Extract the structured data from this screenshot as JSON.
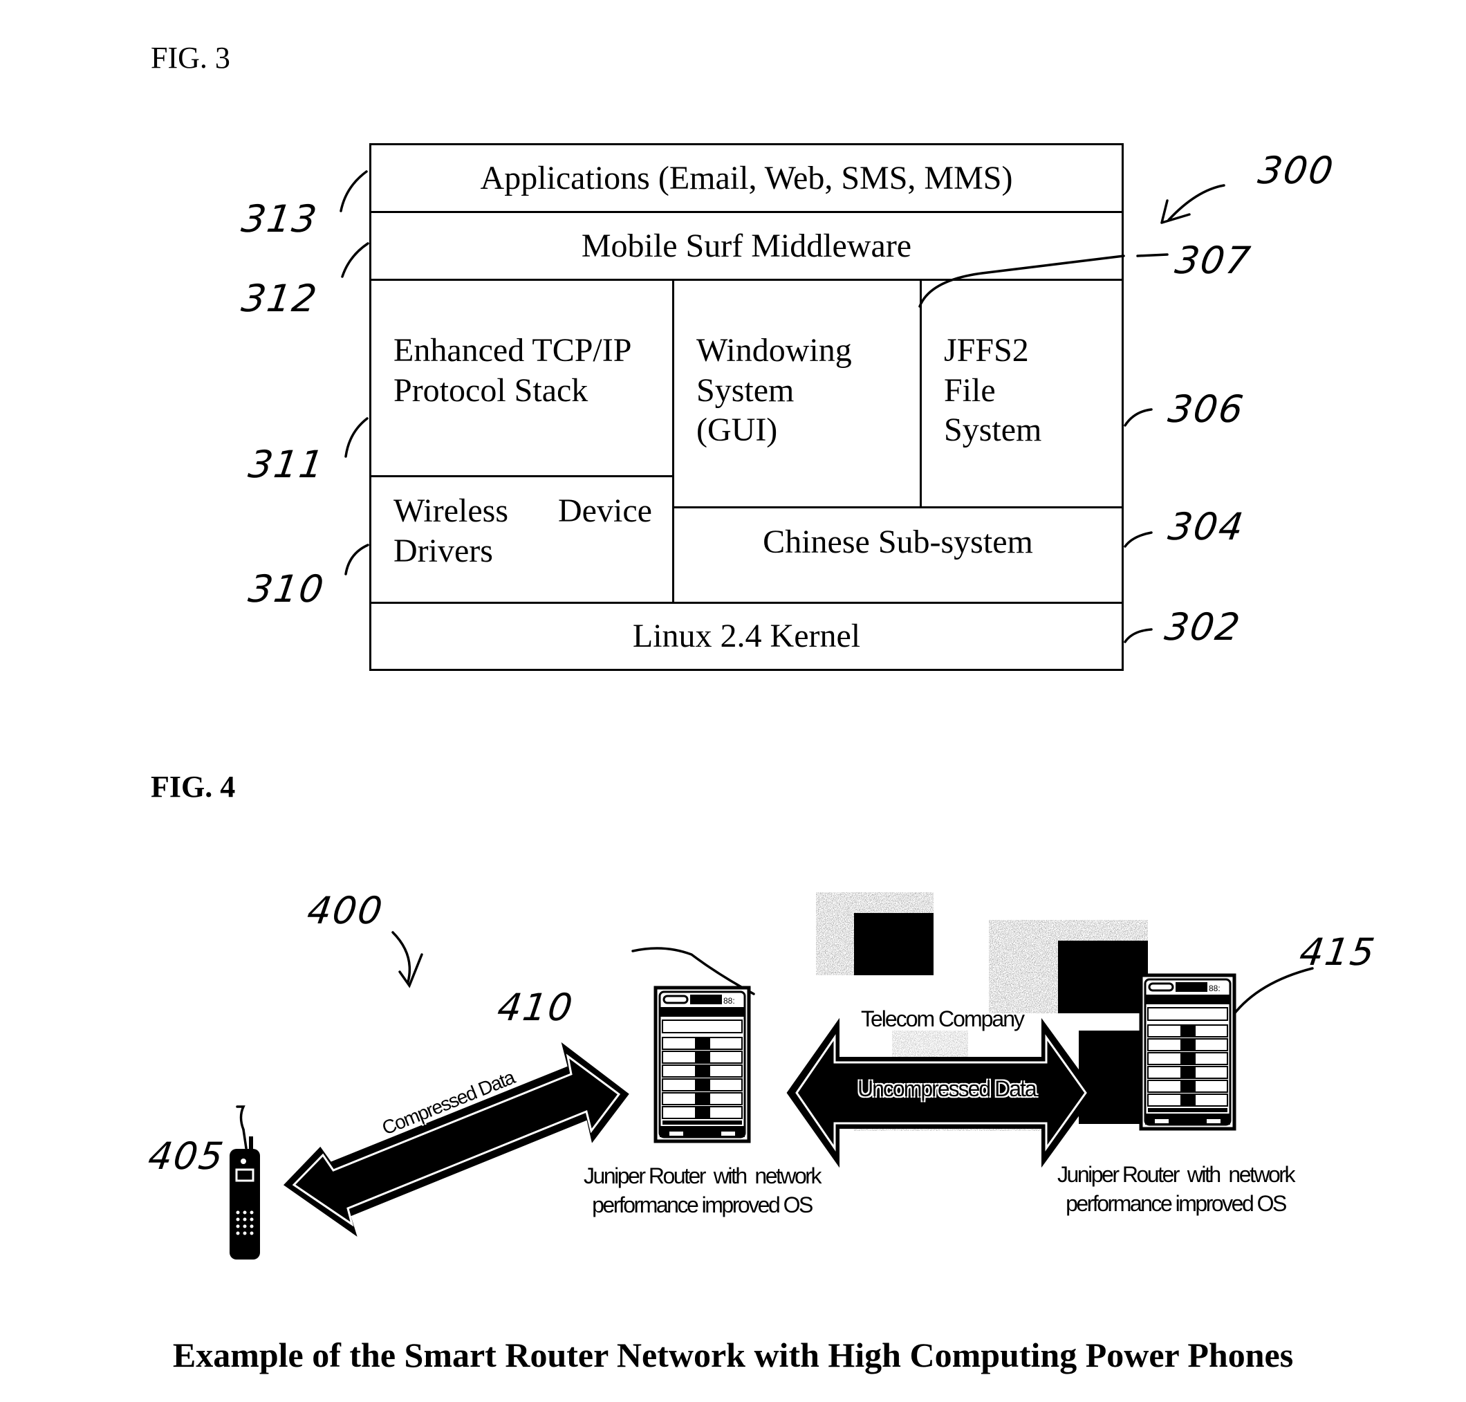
{
  "fig3": {
    "label": "FIG. 3",
    "layers": {
      "applications": "Applications (Email, Web, SMS, MMS)",
      "middleware": "Mobile Surf Middleware",
      "tcpip": [
        "Enhanced TCP/IP",
        "Protocol Stack"
      ],
      "wireless": [
        "Wireless   Device",
        "Drivers"
      ],
      "windowing": [
        "Windowing",
        "System",
        "(GUI)"
      ],
      "jffs2": [
        "JFFS2",
        "File",
        "System"
      ],
      "chinese": "Chinese Sub-system",
      "kernel": "Linux 2.4 Kernel"
    },
    "refs": {
      "r300": "300",
      "r313": "313",
      "r312": "312",
      "r311": "311",
      "r310": "310",
      "r307": "307",
      "r306": "306",
      "r304": "304",
      "r302": "302"
    }
  },
  "fig4": {
    "label": "FIG. 4",
    "refs": {
      "r400": "400",
      "r410": "410",
      "r405": "405",
      "r415": "415"
    },
    "telecom_label": "Telecom Company",
    "compressed_label": "Compressed Data",
    "uncompressed_label": "Uncompressed Data",
    "router_left_caption": [
      "Juniper Router  with  network",
      "performance improved OS"
    ],
    "router_right_caption": [
      "Juniper Router  with  network",
      "performance improved OS"
    ],
    "caption": "Example of the Smart Router Network with High Computing Power Phones"
  }
}
